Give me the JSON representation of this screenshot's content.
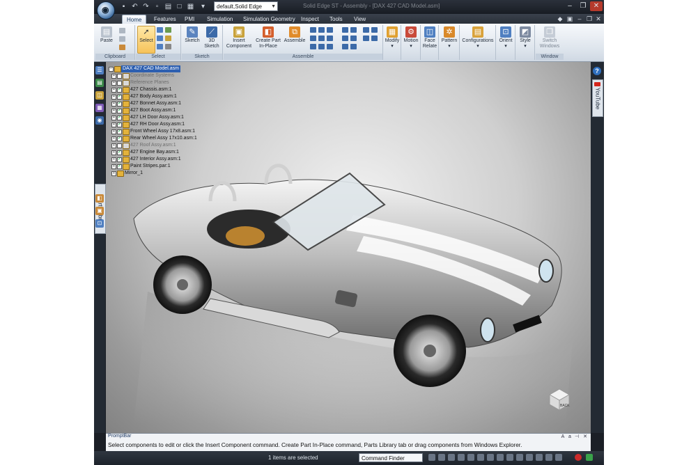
{
  "window": {
    "title": "Solid Edge ST - Assembly - [DAX 427 CAD Model.asm]",
    "environment_select": "default,Solid Edge"
  },
  "tabs": [
    "Home",
    "Features",
    "PMI",
    "Simulation",
    "Simulation Geometry",
    "Inspect",
    "Tools",
    "View"
  ],
  "ribbon": {
    "groups": {
      "clipboard": "Clipboard",
      "select": "Select",
      "sketch": "Sketch",
      "assemble": "Assemble",
      "window": "Window"
    },
    "buttons": {
      "paste": "Paste",
      "select": "Select",
      "sketch": "Sketch",
      "sketch_3d_line1": "3D",
      "sketch_3d_line2": "Sketch",
      "insert_component_line1": "Insert",
      "insert_component_line2": "Component",
      "create_part_line1": "Create Part",
      "create_part_line2": "In-Place",
      "assemble": "Assemble",
      "modify": "Modify",
      "motion": "Motion",
      "face_relate_line1": "Face",
      "face_relate_line2": "Relate",
      "pattern": "Pattern",
      "configurations": "Configurations",
      "orient": "Orient",
      "style": "Style",
      "switch_windows_line1": "Switch",
      "switch_windows_line2": "Windows"
    }
  },
  "left_strip": {
    "parts_library": "Parts Library"
  },
  "right_strip": {
    "youtube": "YouTube",
    "help": "?"
  },
  "pathfinder": {
    "root": "DAX 427 CAD Model.asm",
    "items": [
      {
        "label": "Coordinate Systems",
        "muted": true
      },
      {
        "label": "Reference Planes",
        "muted": true
      },
      {
        "label": "427 Chassis.asm:1"
      },
      {
        "label": "427 Body Assy.asm:1"
      },
      {
        "label": "427 Bonnet Assy.asm:1"
      },
      {
        "label": "427 Boot Assy.asm:1"
      },
      {
        "label": "427 LH Door Assy.asm:1"
      },
      {
        "label": "427 RH Door Assy.asm:1"
      },
      {
        "label": "Front Wheel Assy 17x8.asm:1"
      },
      {
        "label": "Rear Wheel Assy 17x10.asm:1"
      },
      {
        "label": "427 Roof Assy.asm:1",
        "muted": true
      },
      {
        "label": "427 Engine Bay.asm:1"
      },
      {
        "label": "427 Interior Assy.asm:1"
      },
      {
        "label": "Paint Stripes.par:1"
      },
      {
        "label": "Mirror_1"
      }
    ]
  },
  "view_cube": {
    "label": "BACK"
  },
  "prompt_bar": {
    "title": "PromptBar",
    "text": "Select components to edit or click the Insert Component command. Create Part In-Place command, Parts Library tab or drag components from Windows Explorer."
  },
  "status_bar": {
    "selection": "1 items are selected",
    "command_finder": "Command Finder"
  },
  "colors": {
    "accent_select": "#f6c35a",
    "tree_selection": "#2d5fb0",
    "close_button": "#b53a2c"
  }
}
